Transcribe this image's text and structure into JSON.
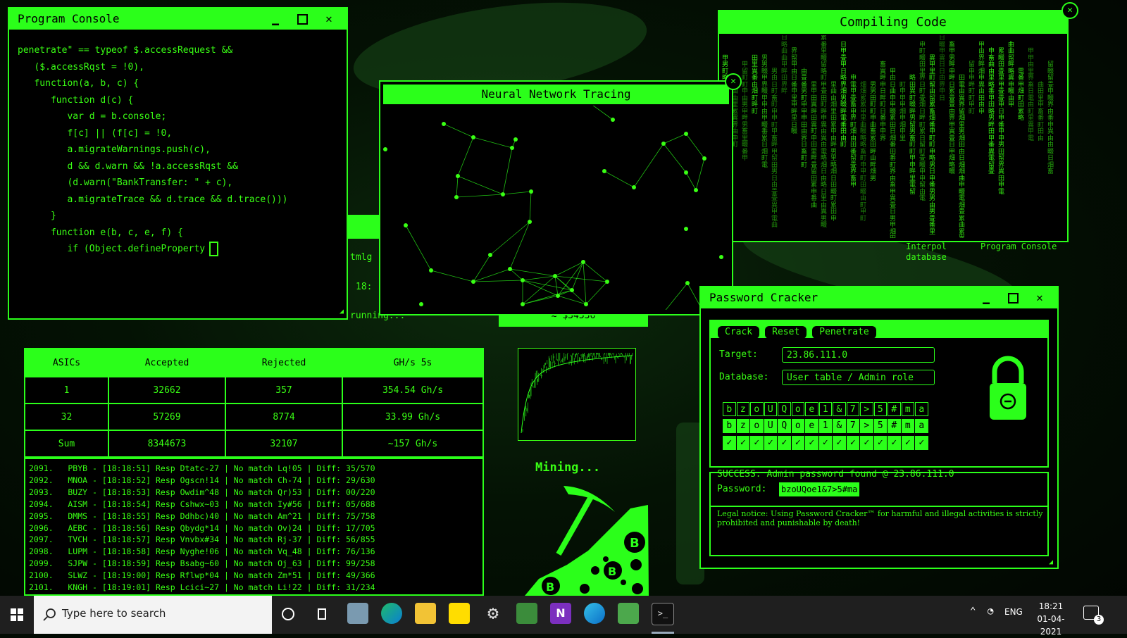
{
  "program_console": {
    "title": "Program Console",
    "lines": [
      "penetrate\" == typeof $.accessRequest &&",
      "   ($.accessRqst = !0),",
      "   function(a, b, c) {",
      "      function d(c) {",
      "         var d = b.console;",
      "         f[c] || (f[c] = !0,",
      "         a.migrateWarnings.push(c),",
      "         d && d.warn && !a.accessRqst &&",
      "         (d.warn(\"BankTransfer: \" + c),",
      "         a.migrateTrace && d.trace && d.trace()))",
      "      }",
      "      function e(b, c, e, f) {",
      "         if (Object.defineProperty"
    ]
  },
  "background_fragments": {
    "text1": "tmlg",
    "text2": "18:",
    "text3": "running...",
    "amount": "$34536"
  },
  "neural_network": {
    "title": "Neural Network Tracing"
  },
  "compiling_code": {
    "title": "Compiling Code"
  },
  "desktop_icons": [
    {
      "label": "Interpol database"
    },
    {
      "label": "Program Console"
    }
  ],
  "mining_stats": {
    "headers": [
      "ASICs",
      "Accepted",
      "Rejected",
      "GH/s 5s"
    ],
    "rows": [
      [
        "1",
        "32662",
        "357",
        "354.54 Gh/s"
      ],
      [
        "32",
        "57269",
        "8774",
        "33.99 Gh/s"
      ],
      [
        "Sum",
        "8344673",
        "32107",
        "~157 Gh/s"
      ]
    ]
  },
  "mining_log": [
    "2091.   PBYB - [18:18:51] Resp Dtatc-27 | No match Lq!05 | Diff: 35/570",
    "2092.   MNOA - [18:18:52] Resp Ogscn!14 | No match Ch-74 | Diff: 29/630",
    "2093.   BUZY - [18:18:53] Resp Owdim^48 | No match Qr)53 | Diff: 00/220",
    "2094.   AISM - [18:18:54] Resp Cshwx~03 | No match Iy#56 | Diff: 05/688",
    "2095.   DMMS - [18:18:55] Resp Ddhbc)40 | No match Am^21 | Diff: 75/758",
    "2096.   AEBC - [18:18:56] Resp Qbydg*14 | No match Ov)24 | Diff: 17/705",
    "2097.   TVCH - [18:18:57] Resp Vnvbx#34 | No match Rj-37 | Diff: 56/855",
    "2098.   LUPM - [18:18:58] Resp Nyghe!06 | No match Vq_48 | Diff: 76/136",
    "2099.   SJPW - [18:18:59] Resp Bsabg~60 | No match Oj_63 | Diff: 99/258",
    "2100.   SLWZ - [18:19:00] Resp Rflwp*04 | No match Zm*51 | Diff: 49/366",
    "2101.   KNGH - [18:19:01] Resp Lcici~27 | No match Li!22 | Diff: 31/234"
  ],
  "mining": {
    "label": "Mining..."
  },
  "password_cracker": {
    "title": "Password Cracker",
    "buttons": [
      "Crack",
      "Reset",
      "Penetrate"
    ],
    "target_label": "Target:",
    "target_value": "23.86.111.0",
    "database_label": "Database:",
    "database_value": "User table / Admin role",
    "chars_top": [
      "b",
      "z",
      "o",
      "U",
      "Q",
      "o",
      "e",
      "1",
      "&",
      "7",
      ">",
      "5",
      "#",
      "m",
      "a"
    ],
    "chars_bottom": [
      "b",
      "z",
      "o",
      "U",
      "Q",
      "o",
      "e",
      "1",
      "&",
      "7",
      ">",
      "5",
      "#",
      "m",
      "a"
    ],
    "check_glyph": "✓",
    "success": "SUCCESS: Admin password found @ 23.86.111.0",
    "password_label": "Password:",
    "password_value": "bzoUQoe1&7>5#ma",
    "legal_notice": "Legal notice: Using Password Cracker™ for harmful and illegal activities is strictly prohibited and punishable by death!"
  },
  "taskbar": {
    "search_placeholder": "Type here to search",
    "language": "ENG",
    "time": "18:21",
    "date": "01-04-2021",
    "notification_count": "3"
  },
  "colors": {
    "accent": "#2bff1a",
    "text": "#39ff14",
    "background": "#000000"
  }
}
